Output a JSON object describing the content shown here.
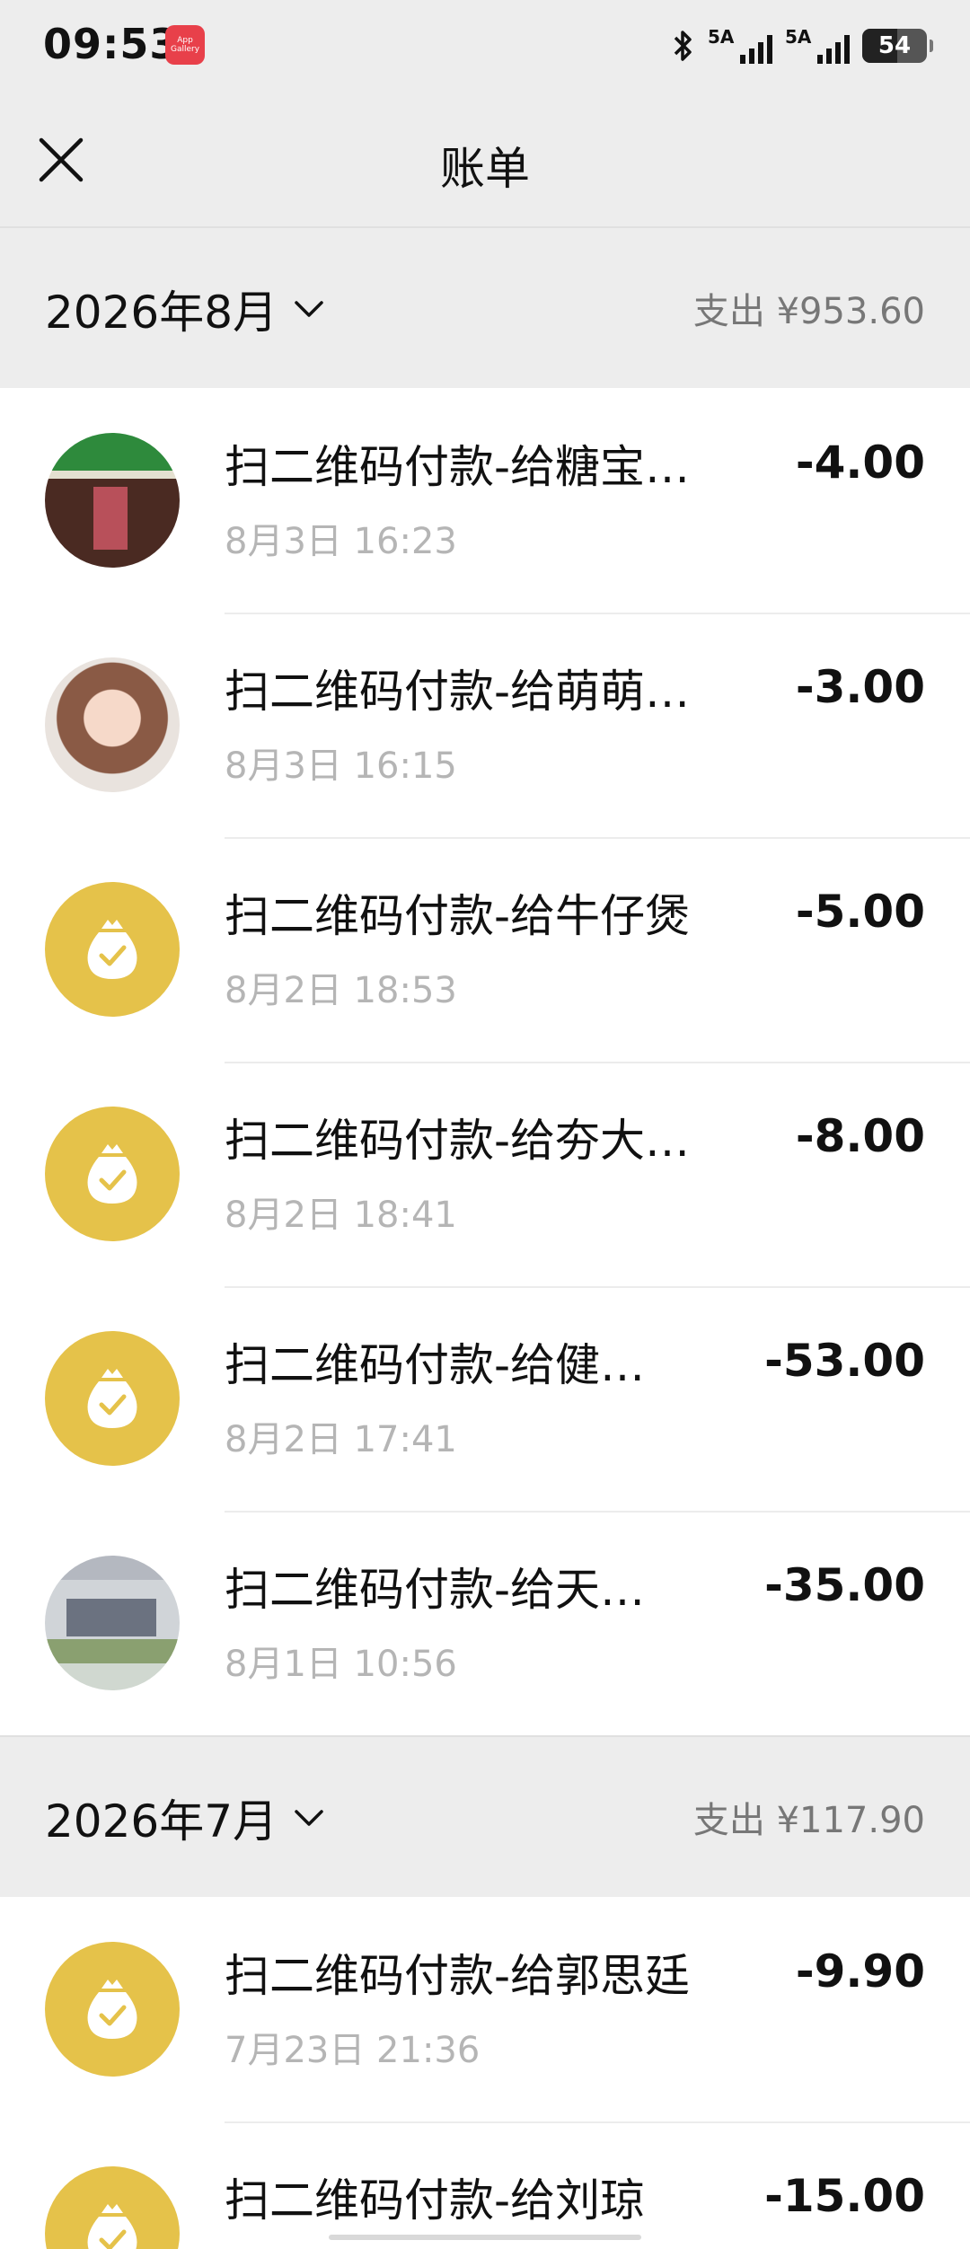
{
  "status_bar": {
    "time": "09:53",
    "app_badge": "App Gallery",
    "signal1_label": "5A",
    "signal2_label": "5A",
    "battery": "54",
    "battery_level_percent": 54
  },
  "header": {
    "title": "账单",
    "close_icon": "close-icon"
  },
  "months": [
    {
      "label": "2026年8月",
      "total": "支出 ¥953.60",
      "transactions": [
        {
          "avatar": "store-photo",
          "title": "扫二维码付款-给糖宝…",
          "time": "8月3日 16:23",
          "amount": "-4.00"
        },
        {
          "avatar": "anime-girl",
          "title": "扫二维码付款-给萌萌…",
          "time": "8月3日 16:15",
          "amount": "-3.00"
        },
        {
          "avatar": "money-bag-icon",
          "title": "扫二维码付款-给牛仔煲",
          "time": "8月2日 18:53",
          "amount": "-5.00"
        },
        {
          "avatar": "money-bag-icon",
          "title": "扫二维码付款-给夯大…",
          "time": "8月2日 18:41",
          "amount": "-8.00"
        },
        {
          "avatar": "money-bag-icon",
          "title": "扫二维码付款-给健…",
          "time": "8月2日 17:41",
          "amount": "-53.00"
        },
        {
          "avatar": "building-photo",
          "title": "扫二维码付款-给天…",
          "time": "8月1日 10:56",
          "amount": "-35.00"
        }
      ]
    },
    {
      "label": "2026年7月",
      "total": "支出 ¥117.90",
      "transactions": [
        {
          "avatar": "money-bag-icon",
          "title": "扫二维码付款-给郭思廷",
          "time": "7月23日 21:36",
          "amount": "-9.90"
        },
        {
          "avatar": "money-bag-icon",
          "title": "扫二维码付款-给刘琼",
          "time": "",
          "amount": "-15.00"
        }
      ]
    }
  ],
  "colors": {
    "background": "#ededed",
    "coin_yellow": "#e5c24a",
    "muted_text": "#b5b5b5"
  }
}
